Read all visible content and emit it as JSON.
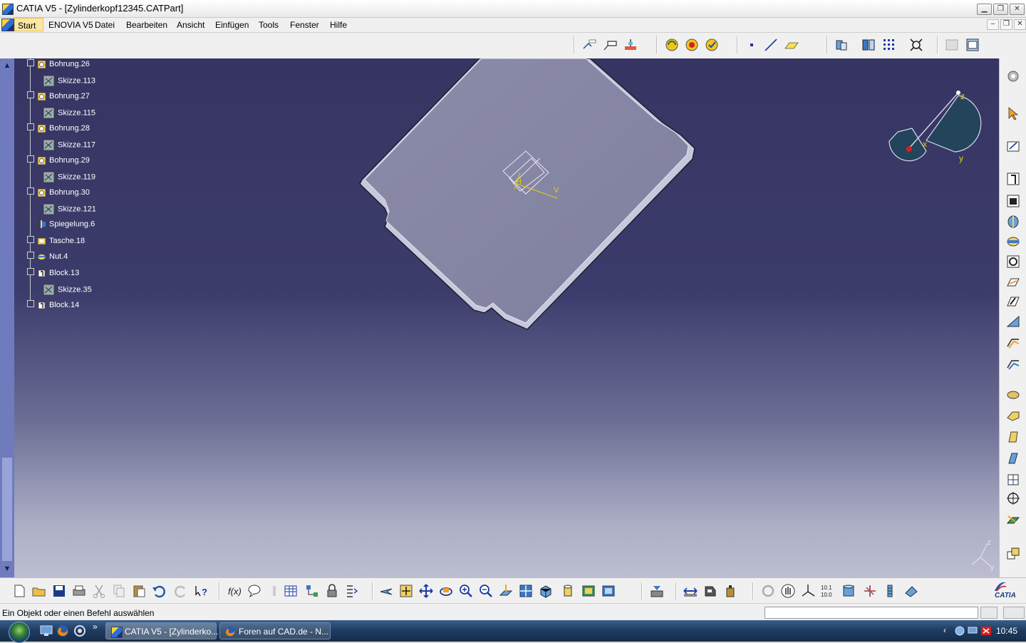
{
  "window": {
    "title": "CATIA V5 - [Zylinderkopf12345.CATPart]",
    "controls": {
      "minimize": "▁",
      "restore": "❐",
      "close": "✕"
    }
  },
  "menubar": {
    "items": [
      {
        "label": "Start",
        "active": true
      },
      {
        "label": "ENOVIA V5"
      },
      {
        "label": "Datei"
      },
      {
        "label": "Bearbeiten"
      },
      {
        "label": "Ansicht"
      },
      {
        "label": "Einfügen"
      },
      {
        "label": "Tools"
      },
      {
        "label": "Fenster"
      },
      {
        "label": "Hilfe"
      }
    ],
    "doc_controls": {
      "minimize": "–",
      "restore": "❐",
      "close": "✕"
    }
  },
  "tree": {
    "nodes": [
      {
        "label": "Bohrung.26",
        "icon": "hole-icon",
        "level": 1
      },
      {
        "label": "Skizze.113",
        "icon": "sketch-icon",
        "level": 2
      },
      {
        "label": "Bohrung.27",
        "icon": "hole-icon",
        "level": 1
      },
      {
        "label": "Skizze.115",
        "icon": "sketch-icon",
        "level": 2
      },
      {
        "label": "Bohrung.28",
        "icon": "hole-icon",
        "level": 1
      },
      {
        "label": "Skizze.117",
        "icon": "sketch-icon",
        "level": 2
      },
      {
        "label": "Bohrung.29",
        "icon": "hole-icon",
        "level": 1
      },
      {
        "label": "Skizze.119",
        "icon": "sketch-icon",
        "level": 2
      },
      {
        "label": "Bohrung.30",
        "icon": "hole-icon",
        "level": 1
      },
      {
        "label": "Skizze.121",
        "icon": "sketch-icon",
        "level": 2
      },
      {
        "label": "Spiegelung.6",
        "icon": "mirror-icon",
        "level": 1
      },
      {
        "label": "Tasche.18",
        "icon": "pocket-icon",
        "level": 1
      },
      {
        "label": "Nut.4",
        "icon": "groove-icon",
        "level": 1
      },
      {
        "label": "Block.13",
        "icon": "pad-icon",
        "level": 1
      },
      {
        "label": "Skizze.35",
        "icon": "sketch-icon",
        "level": 2
      },
      {
        "label": "Block.14",
        "icon": "pad-icon",
        "level": 1
      }
    ]
  },
  "compass": {
    "x": "x",
    "y": "y",
    "z": "z"
  },
  "axis_triad": {
    "y": "y",
    "z": "z"
  },
  "part_axis": {
    "h": "H",
    "v": "V"
  },
  "status": {
    "text": "Ein Objekt oder einen Befehl auswählen",
    "command_placeholder": ""
  },
  "taskbar": {
    "buttons": [
      {
        "label": "CATIA V5 - [Zylinderko...",
        "active": true
      },
      {
        "label": "Foren auf CAD.de - N..."
      }
    ],
    "clock": "10:45",
    "quicklaunch_more": "»"
  },
  "brand": {
    "logo_text": "CATIA"
  },
  "colors": {
    "viewport_top": "#363462",
    "viewport_bottom": "#bcbdd0",
    "menu_highlight": "#fbe7a5"
  }
}
